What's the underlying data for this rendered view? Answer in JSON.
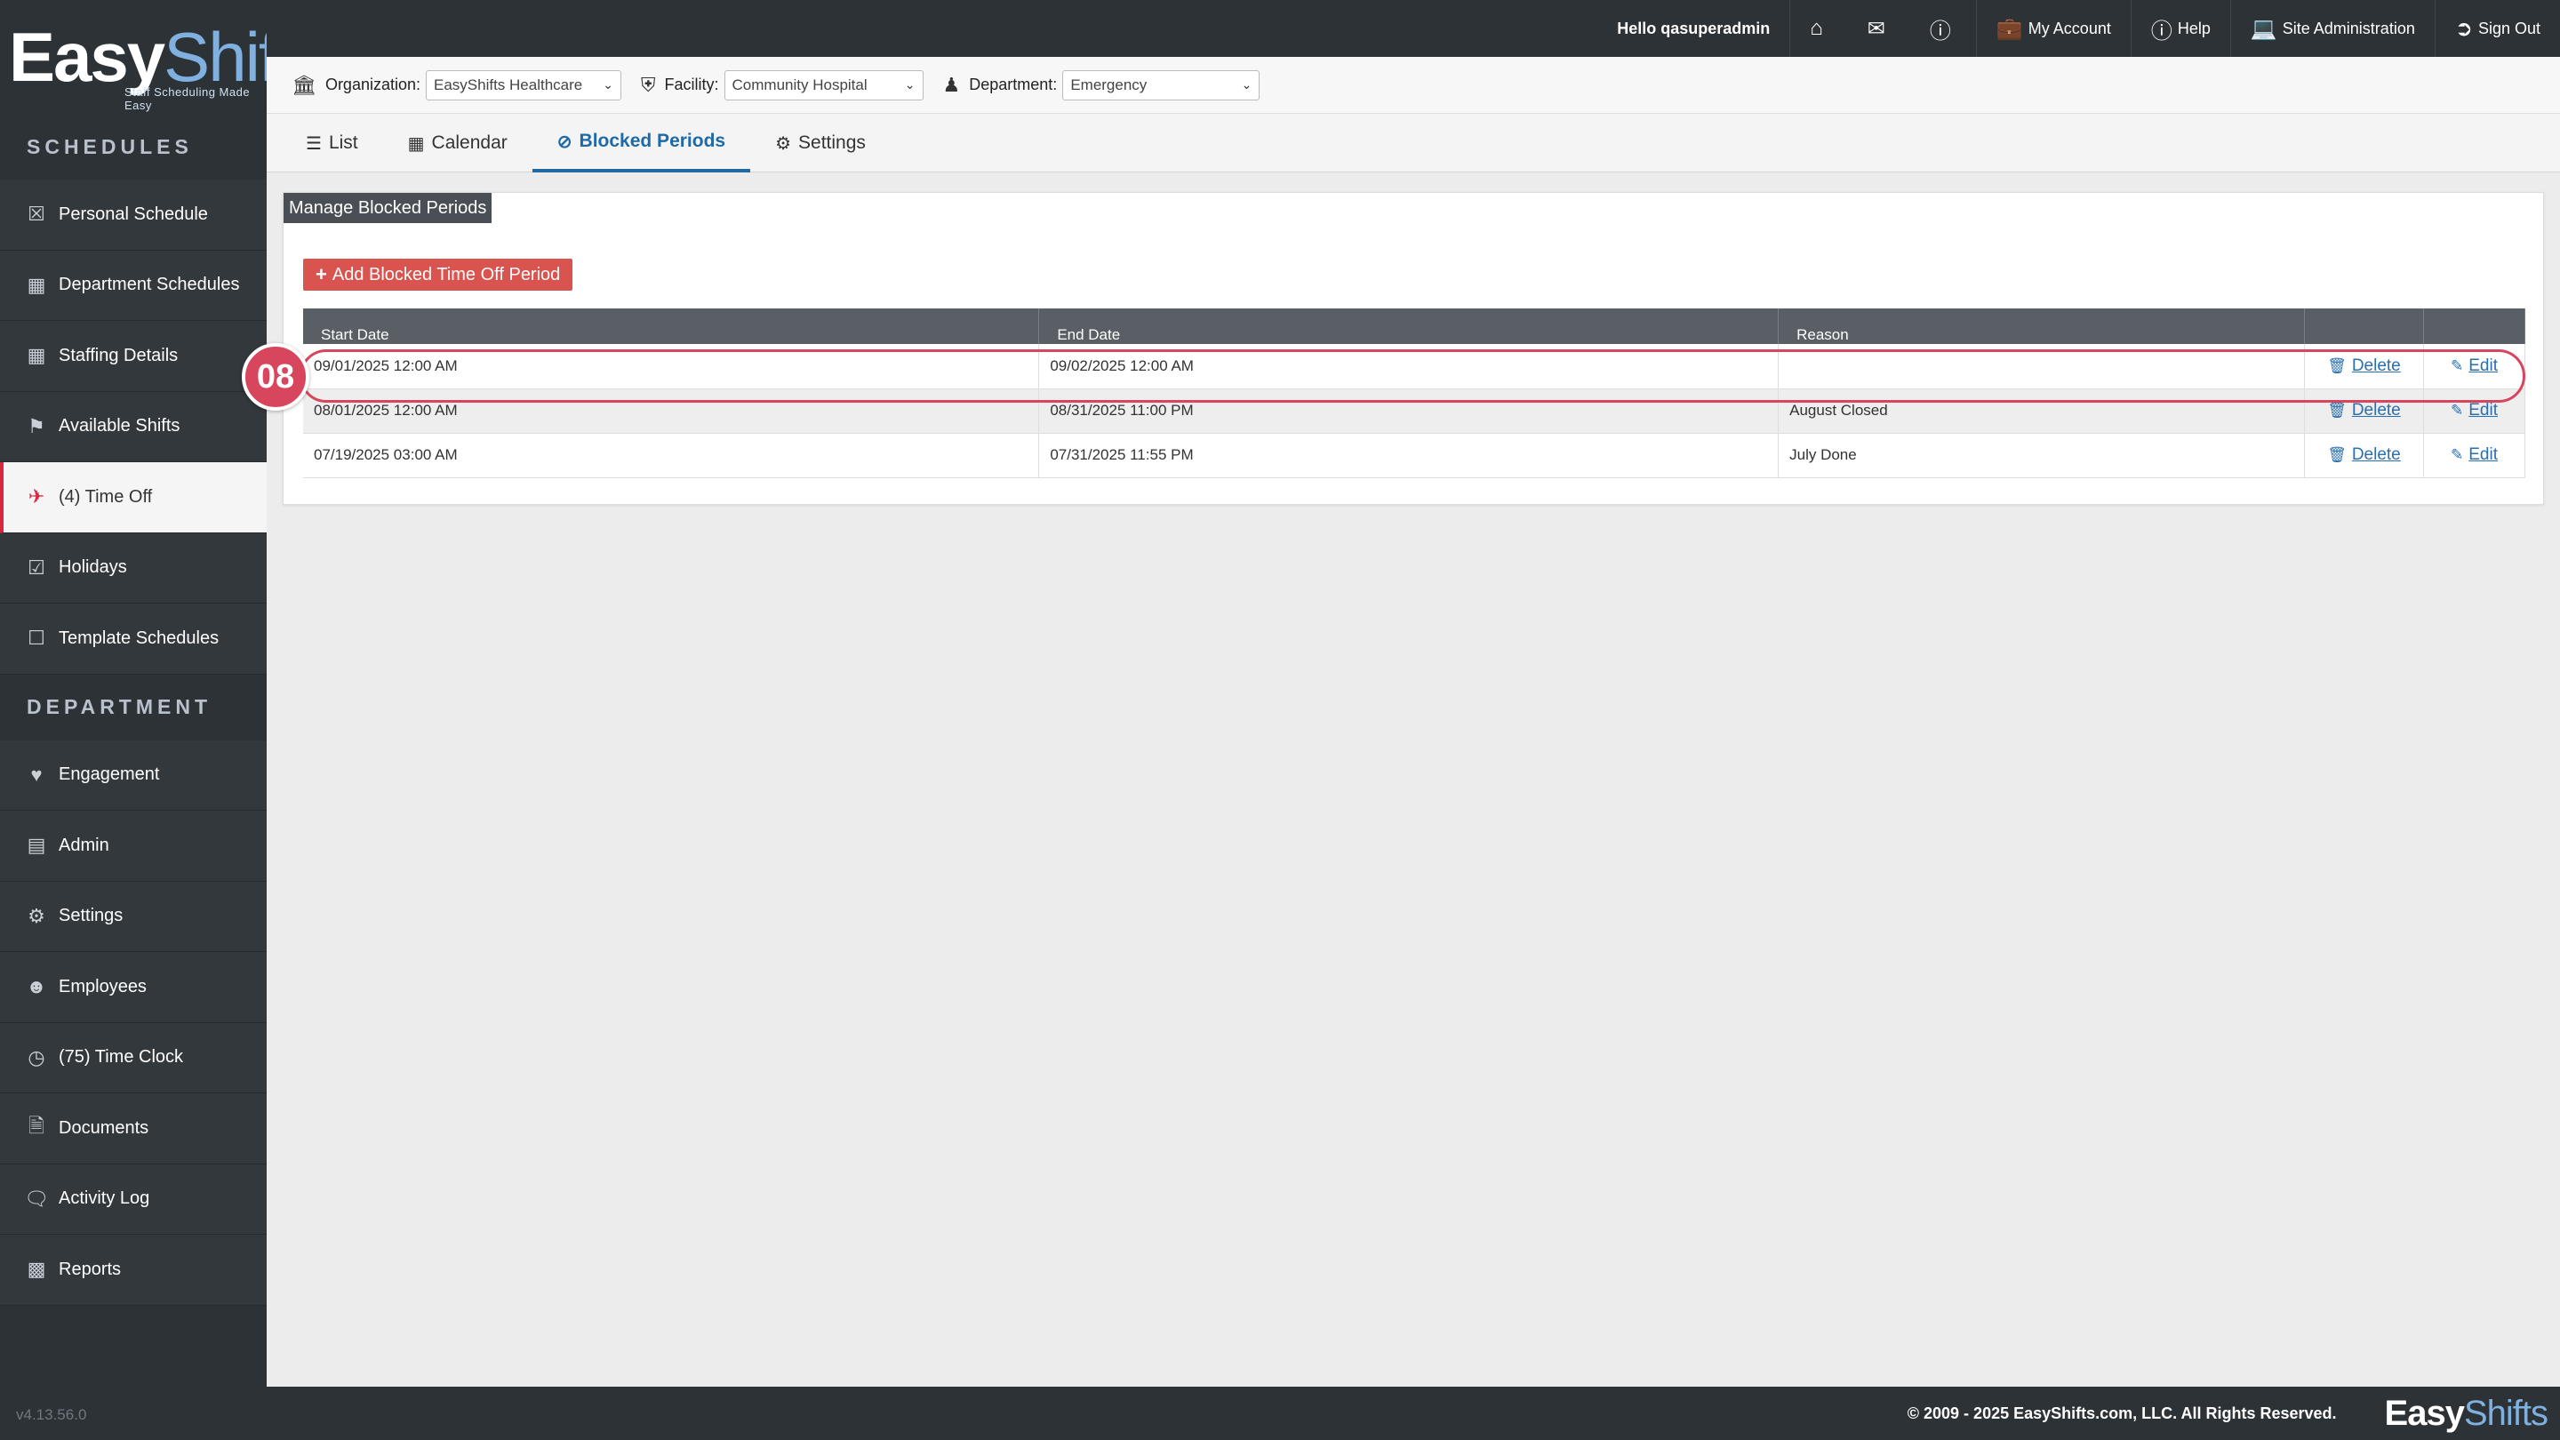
{
  "app": {
    "logo_part1": "Easy",
    "logo_part2": "Shifts",
    "tagline": "Staff Scheduling Made Easy",
    "version": "v4.13.56.0"
  },
  "topbar": {
    "greeting": "Hello qasuperadmin",
    "my_account": "My Account",
    "help": "Help",
    "site_admin": "Site Administration",
    "sign_out": "Sign Out"
  },
  "filters": {
    "organization_label": "Organization:",
    "organization_value": "EasyShifts Healthcare",
    "facility_label": "Facility:",
    "facility_value": "Community Hospital",
    "department_label": "Department:",
    "department_value": "Emergency"
  },
  "sidebar": {
    "schedules_heading": "SCHEDULES",
    "department_heading": "DEPARTMENT",
    "schedules_items": [
      {
        "label": "Personal Schedule",
        "icon": "calendar-x-icon"
      },
      {
        "label": "Department Schedules",
        "icon": "calendar-grid-icon"
      },
      {
        "label": "Staffing Details",
        "icon": "table-icon"
      },
      {
        "label": "Available Shifts",
        "icon": "flag-icon"
      },
      {
        "label": "(4) Time Off",
        "icon": "plane-icon"
      },
      {
        "label": "Holidays",
        "icon": "calendar-check-icon"
      },
      {
        "label": "Template Schedules",
        "icon": "calendar-blank-icon"
      }
    ],
    "department_items": [
      {
        "label": "Engagement",
        "icon": "heart-icon"
      },
      {
        "label": "Admin",
        "icon": "clipboard-icon"
      },
      {
        "label": "Settings",
        "icon": "gear-icon"
      },
      {
        "label": "Employees",
        "icon": "users-icon"
      },
      {
        "label": "(75) Time Clock",
        "icon": "clock-icon"
      },
      {
        "label": "Documents",
        "icon": "document-icon"
      },
      {
        "label": "Activity Log",
        "icon": "comments-icon"
      },
      {
        "label": "Reports",
        "icon": "bar-chart-icon"
      }
    ]
  },
  "tabs": {
    "list": "List",
    "calendar": "Calendar",
    "blocked_periods": "Blocked Periods",
    "settings": "Settings"
  },
  "panel": {
    "title": "Manage Blocked Periods",
    "add_button": "Add Blocked Time Off Period",
    "columns": [
      "Start Date",
      "End Date",
      "Reason",
      "",
      ""
    ],
    "delete_label": "Delete",
    "edit_label": "Edit",
    "rows": [
      {
        "start": "09/01/2025 12:00 AM",
        "end": "09/02/2025 12:00 AM",
        "reason": ""
      },
      {
        "start": "08/01/2025 12:00 AM",
        "end": "08/31/2025 11:00 PM",
        "reason": "August Closed"
      },
      {
        "start": "07/19/2025 03:00 AM",
        "end": "07/31/2025 11:55 PM",
        "reason": "July Done"
      }
    ]
  },
  "annotation": {
    "step": "08"
  },
  "footer": {
    "copyright": "© 2009 - 2025 EasyShifts.com, LLC. All Rights Reserved."
  },
  "colors": {
    "sidebar_bg": "#2d3237",
    "accent_red": "#d9534f",
    "link_blue": "#2a6fb0",
    "tab_active": "#1f6aa5"
  }
}
